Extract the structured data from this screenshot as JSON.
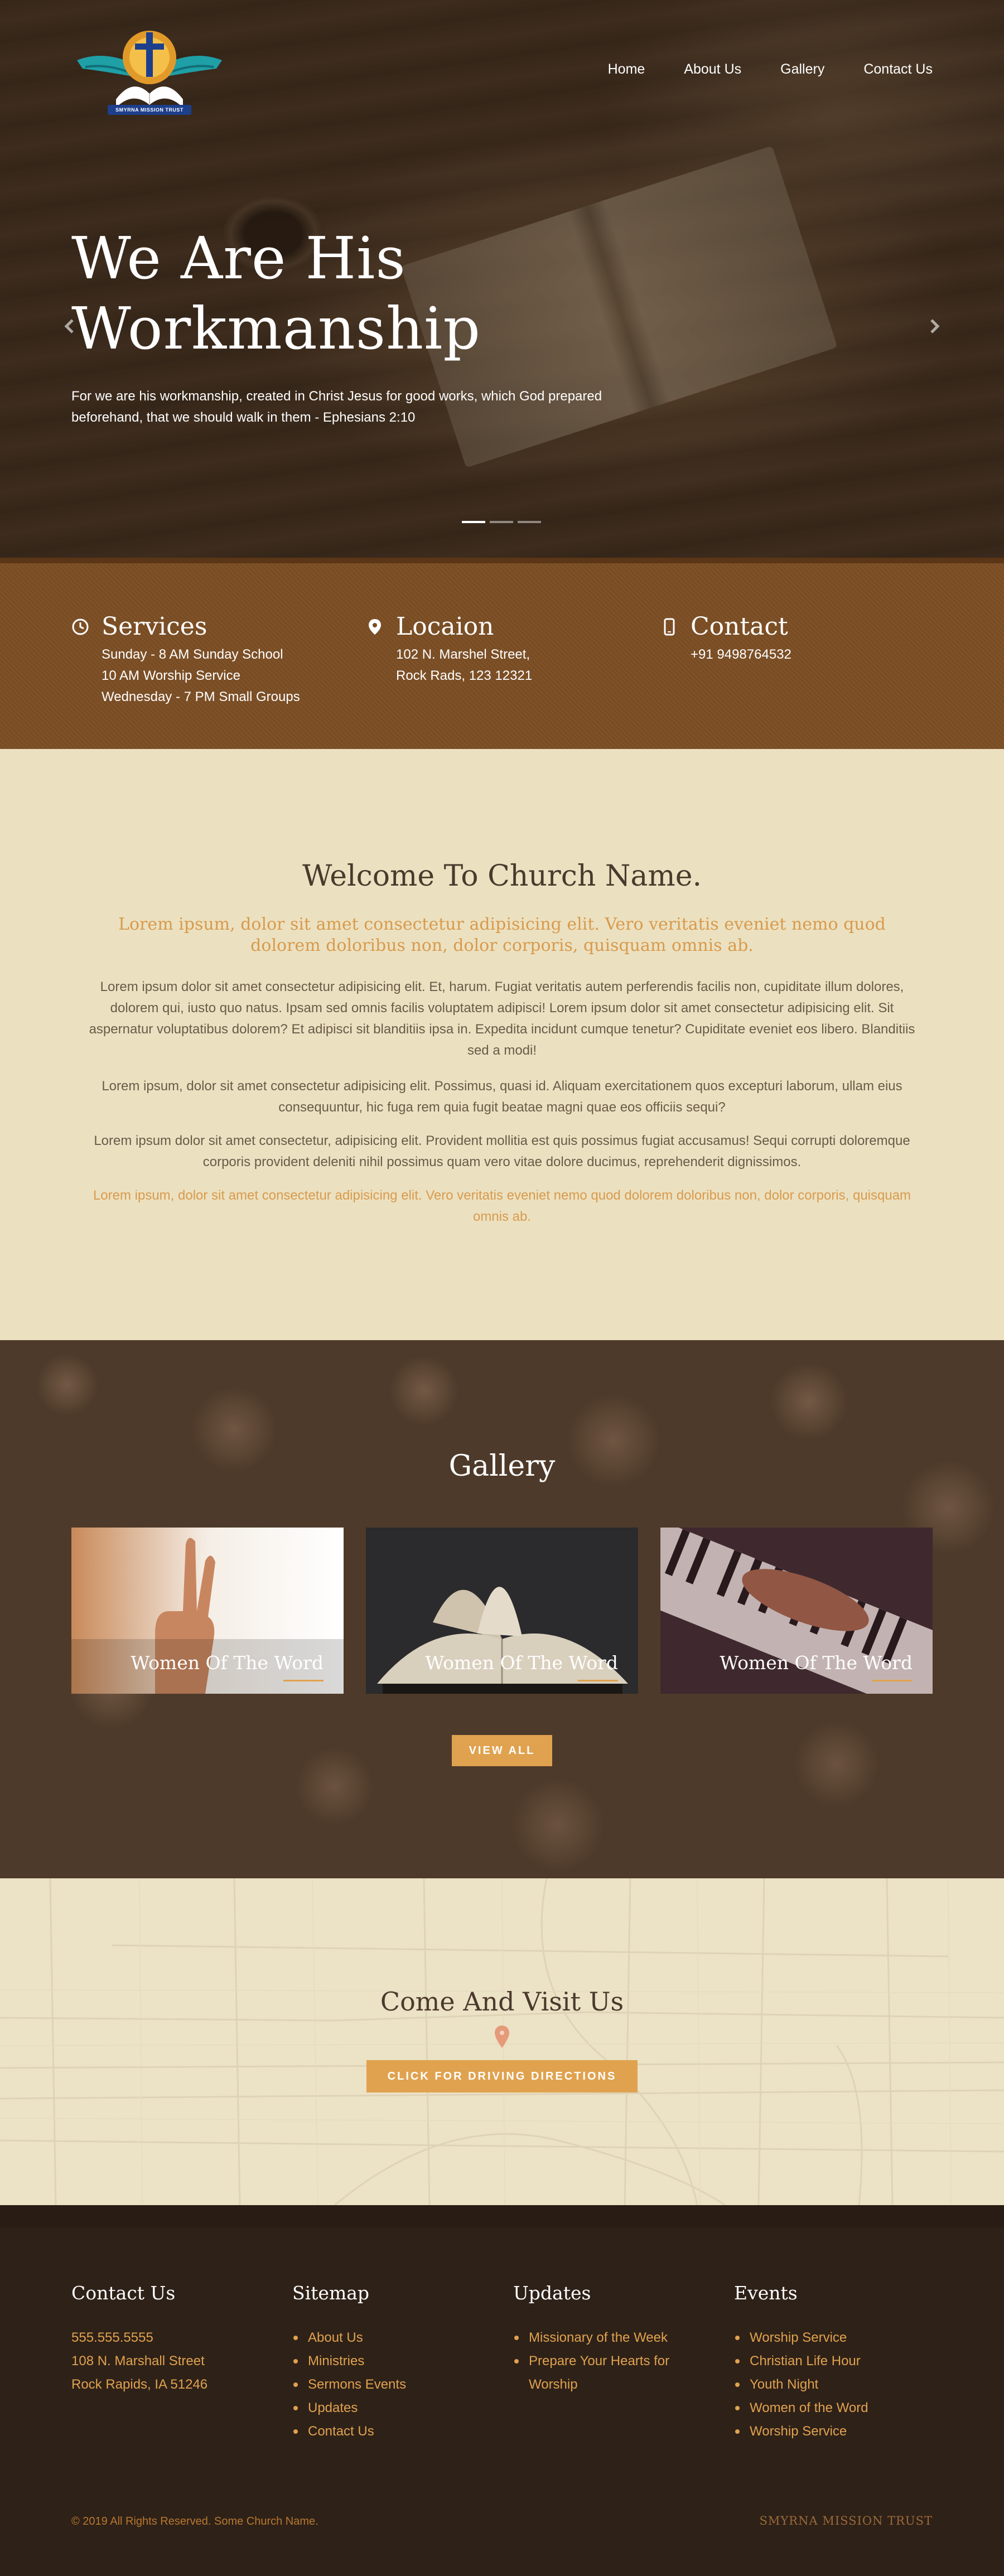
{
  "header": {
    "logo_text": "SMYRNA MISSION TRUST",
    "nav": [
      "Home",
      "About Us",
      "Gallery",
      "Contact Us"
    ]
  },
  "hero": {
    "title_line1": "We Are His",
    "title_line2": "Workmanship",
    "subtitle": "For we are his workmanship, created in Christ Jesus for good works, which God prepared beforehand, that we should walk in them - Ephesians 2:10",
    "slide_count": 3,
    "active_slide": 1
  },
  "info": {
    "services": {
      "title": "Services",
      "icon": "clock-icon",
      "lines": [
        "Sunday - 8 AM Sunday School",
        "10 AM Worship Service",
        "Wednesday - 7 PM Small Groups"
      ]
    },
    "location": {
      "title": "Locaion",
      "icon": "map-pin-icon",
      "lines": [
        "102 N. Marshel Street,",
        "Rock Rads, 123 12321"
      ]
    },
    "contact": {
      "title": "Contact",
      "icon": "phone-icon",
      "lines": [
        "+91 9498764532"
      ]
    }
  },
  "welcome": {
    "title": "Welcome To Church Name.",
    "lead": "Lorem ipsum, dolor sit amet consectetur adipisicing elit. Vero veritatis eveniet nemo quod dolorem doloribus non, dolor corporis, quisquam omnis ab.",
    "p1": "Lorem ipsum dolor sit amet consectetur adipisicing elit. Et, harum. Fugiat veritatis autem perferendis facilis non, cupiditate illum dolores, dolorem qui, iusto quo natus. Ipsam sed omnis facilis voluptatem adipisci! Lorem ipsum dolor sit amet consectetur adipisicing elit. Sit aspernatur voluptatibus dolorem? Et adipisci sit blanditiis ipsa in. Expedita incidunt cumque tenetur? Cupiditate eveniet eos libero. Blanditiis sed a modi!",
    "p2": "Lorem ipsum, dolor sit amet consectetur adipisicing elit. Possimus, quasi id. Aliquam exercitationem quos excepturi laborum, ullam eius consequuntur, hic fuga rem quia fugit beatae magni quae eos officiis sequi?",
    "p3": "Lorem ipsum dolor sit amet consectetur, adipisicing elit. Provident mollitia est quis possimus fugiat accusamus! Sequi corrupti doloremque corporis provident deleniti nihil possimus quam vero vitae dolore ducimus, reprehenderit dignissimos.",
    "p4": "Lorem ipsum, dolor sit amet consectetur adipisicing elit. Vero veritatis eveniet nemo quod dolorem doloribus non, dolor corporis, quisquam omnis ab."
  },
  "gallery": {
    "title": "Gallery",
    "items": [
      {
        "caption": "Women Of The Word",
        "image": "peace-sign-hand"
      },
      {
        "caption": "Women Of The Word",
        "image": "open-bible"
      },
      {
        "caption": "Women Of The Word",
        "image": "piano-keys-hands"
      }
    ],
    "view_all": "VIEW ALL"
  },
  "map": {
    "title": "Come And Visit Us",
    "button": "CLICK FOR DRIVING DIRECTIONS"
  },
  "footer": {
    "contact": {
      "title": "Contact Us",
      "lines": [
        "555.555.5555",
        "108 N. Marshall Street",
        "Rock Rapids, IA 51246"
      ]
    },
    "sitemap": {
      "title": "Sitemap",
      "items": [
        "About Us",
        "Ministries",
        "Sermons Events",
        "Updates",
        "Contact Us"
      ]
    },
    "updates": {
      "title": "Updates",
      "items": [
        "Missionary of the Week",
        "Prepare Your Hearts for Worship"
      ]
    },
    "events": {
      "title": "Events",
      "items": [
        "Worship Service",
        "Christian Life Hour",
        "Youth Night",
        "Women of the Word",
        "Worship Service"
      ]
    },
    "copyright": "© 2019 All Rights Reserved. Some Church Name.",
    "brand": "SMYRNA MISSION TRUST"
  },
  "colors": {
    "accent": "#e0a24f",
    "cream": "#ebe1c1",
    "brown": "#7a4d24",
    "footer": "#2e2118"
  }
}
